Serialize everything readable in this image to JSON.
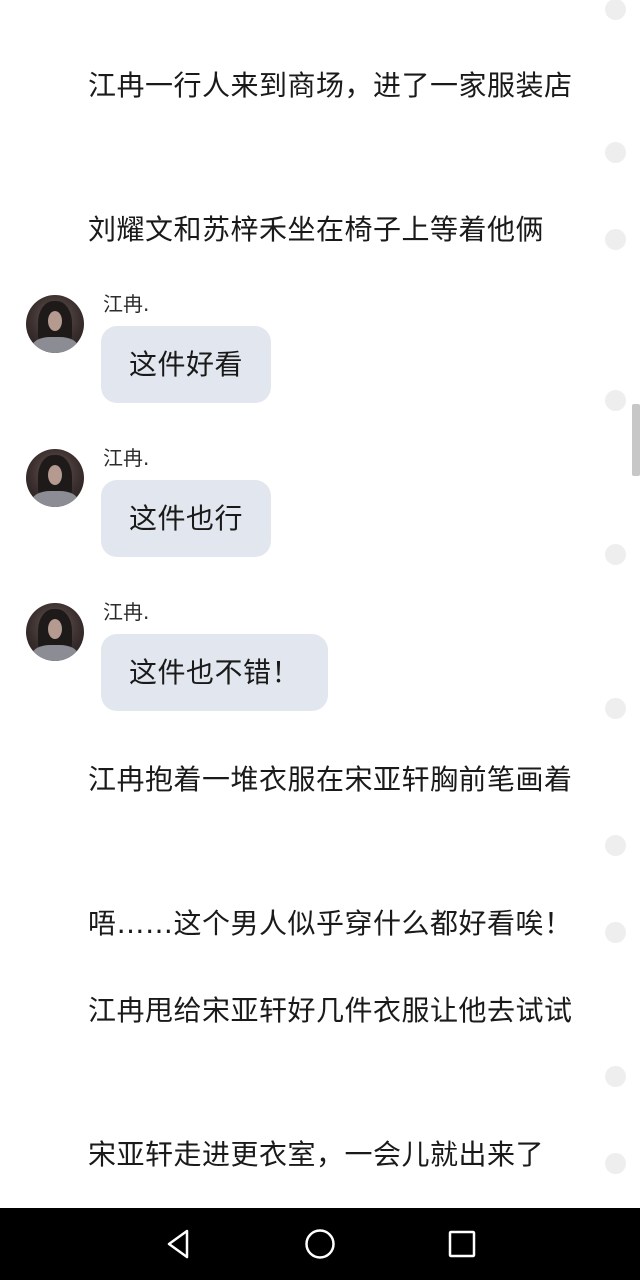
{
  "story": {
    "p1": "江冉一行人来到商场，进了一家服装店",
    "p2": "刘耀文和苏梓禾坐在椅子上等着他俩",
    "p3": "江冉抱着一堆衣服在宋亚轩胸前笔画着",
    "p4": "唔……这个男人似乎穿什么都好看唉！",
    "p5": "江冉甩给宋亚轩好几件衣服让他去试试",
    "p6": "宋亚轩走进更衣室，一会儿就出来了"
  },
  "chat": [
    {
      "speaker": "江冉.",
      "text": "这件好看"
    },
    {
      "speaker": "江冉.",
      "text": "这件也行"
    },
    {
      "speaker": "江冉.",
      "text": "这件也不错！"
    }
  ],
  "navbar": {
    "back": "back-icon",
    "home": "home-icon",
    "recents": "recents-icon"
  },
  "colors": {
    "bubble": "#e2e7ef",
    "navbar": "#000000",
    "text": "#1a1a1a",
    "dot": "#eeeeee"
  }
}
